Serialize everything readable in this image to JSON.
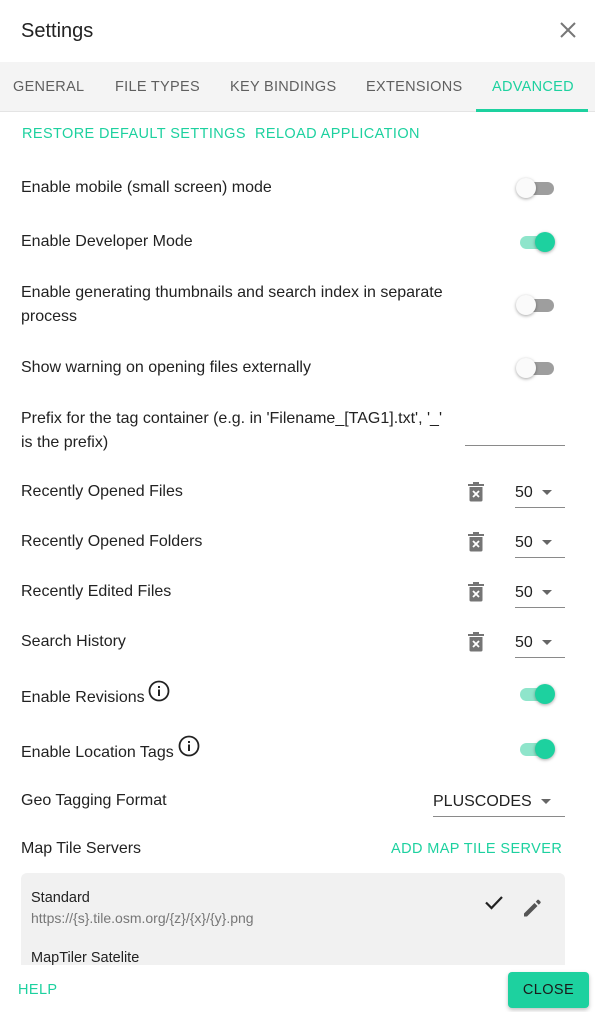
{
  "dialog": {
    "title": "Settings"
  },
  "tabs": [
    {
      "label": "GENERAL"
    },
    {
      "label": "FILE TYPES"
    },
    {
      "label": "KEY BINDINGS"
    },
    {
      "label": "EXTENSIONS"
    },
    {
      "label": "ADVANCED",
      "active": true
    }
  ],
  "actions": {
    "restore_defaults": "RESTORE DEFAULT SETTINGS",
    "reload_app": "RELOAD APPLICATION"
  },
  "settings": {
    "mobile_mode": {
      "label": "Enable mobile (small screen) mode",
      "enabled": false
    },
    "developer_mode": {
      "label": "Enable Developer Mode",
      "enabled": true
    },
    "separate_process": {
      "label_line1": "Enable generating thumbnails and search index in separate",
      "label_line2": "process",
      "enabled": false
    },
    "warn_external": {
      "label": "Show warning on opening files externally",
      "enabled": false
    },
    "tag_prefix": {
      "label_line1": "Prefix for the tag container (e.g. in 'Filename_[TAG1].txt', '_'",
      "label_line2": "is the prefix)",
      "value": ""
    },
    "recent_files": {
      "label": "Recently Opened Files",
      "value": "50"
    },
    "recent_folders": {
      "label": "Recently Opened Folders",
      "value": "50"
    },
    "recent_edited": {
      "label": "Recently Edited Files",
      "value": "50"
    },
    "search_history": {
      "label": "Search History",
      "value": "50"
    },
    "revisions": {
      "label": "Enable Revisions",
      "enabled": true
    },
    "location_tags": {
      "label": "Enable Location Tags",
      "enabled": true
    },
    "geo_format": {
      "label": "Geo Tagging Format",
      "value": "PLUSCODES"
    },
    "map_tiles": {
      "label": "Map Tile Servers",
      "add_label": "ADD MAP TILE SERVER",
      "servers": [
        {
          "name": "Standard",
          "url": "https://{s}.tile.osm.org/{z}/{x}/{y}.png"
        },
        {
          "name": "MapTiler Satelite",
          "url": ""
        }
      ]
    }
  },
  "footer": {
    "help": "HELP",
    "close": "CLOSE"
  },
  "colors": {
    "accent": "#1dd19f",
    "accent_light": "#8fe5cb",
    "tab_bar": "#f4f4f4",
    "tile_bg": "#f1f1f1"
  },
  "icons": {
    "close": "close-icon",
    "trash": "trash-icon",
    "info": "info-icon",
    "check": "check-icon",
    "edit": "pencil-icon",
    "dropdown": "caret-down-icon"
  }
}
